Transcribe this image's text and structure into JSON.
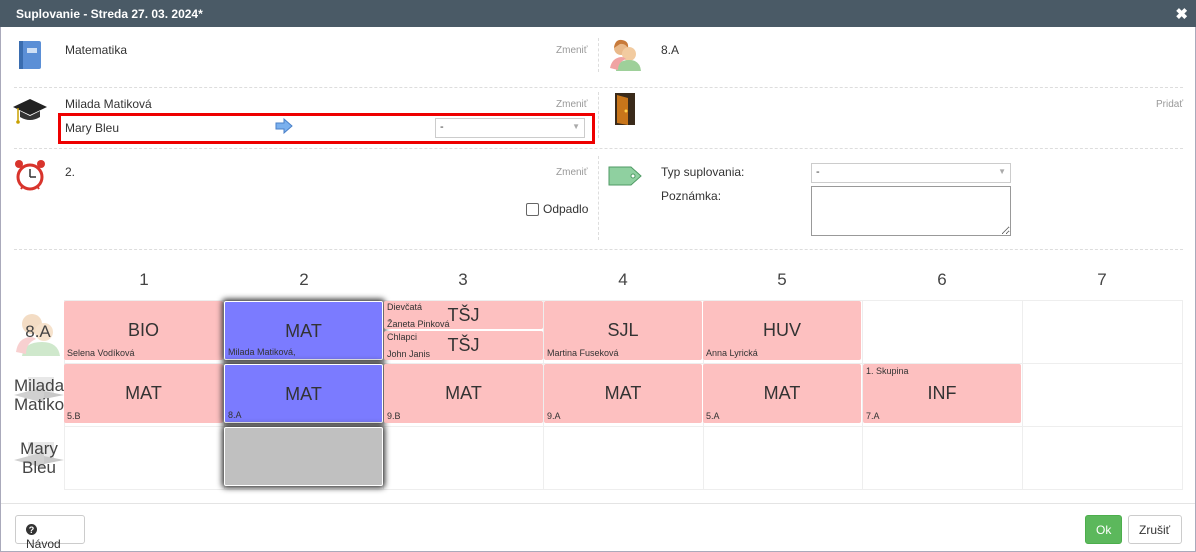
{
  "dialog": {
    "title": "Suplovanie - Streda 27. 03. 2024*",
    "close": "✖"
  },
  "subject": {
    "icon": "book-icon",
    "value": "Matematika",
    "change": "Zmeniť"
  },
  "klass": {
    "icon": "students-icon",
    "value": "8.A"
  },
  "teacher": {
    "icon": "graduation-cap-icon",
    "value": "Milada Matiková",
    "change": "Zmeniť",
    "substitute": "Mary Bleu",
    "arrow": "⇨",
    "select_value": "-"
  },
  "room": {
    "icon": "door-icon",
    "add": "Pridať"
  },
  "period": {
    "icon": "alarm-clock-icon",
    "value": "2.",
    "change": "Zmeniť",
    "cancelled_label": "Odpadlo"
  },
  "type": {
    "icon": "tag-icon",
    "label": "Typ suplovania:",
    "value": "-",
    "note_label": "Poznámka:"
  },
  "grid": {
    "columns": [
      "1",
      "2",
      "3",
      "4",
      "5",
      "6",
      "7"
    ],
    "rows": [
      {
        "label": "8.A",
        "icon": "students-icon"
      },
      {
        "label": "Milada Matiko",
        "icon": "teacher-icon"
      },
      {
        "label": "Mary Bleu",
        "icon": "teacher-icon"
      }
    ],
    "row1": [
      {
        "subject": "BIO",
        "note": "Selena Vodíková"
      },
      {
        "subject": "MAT",
        "note": "Milada Matiková,"
      },
      {
        "groups": [
          {
            "group": "Dievčatá",
            "subject": "TŠJ",
            "note": "Žaneta Pinková"
          },
          {
            "group": "Chlapci",
            "subject": "TŠJ",
            "note": "John Janis"
          }
        ]
      },
      {
        "subject": "SJL",
        "note": "Martina Fuseková"
      },
      {
        "subject": "HUV",
        "note": "Anna Lyrická"
      }
    ],
    "row2": [
      {
        "subject": "MAT",
        "note": "5.B"
      },
      {
        "subject": "MAT",
        "note": "8.A"
      },
      {
        "subject": "MAT",
        "note": "9.B"
      },
      {
        "subject": "MAT",
        "note": "9.A"
      },
      {
        "subject": "MAT",
        "note": "5.A"
      },
      {
        "subject": "INF",
        "note": "7.A",
        "group": "1. Skupina"
      }
    ]
  },
  "footer": {
    "help": "Návod",
    "help_icon": "question-circle-icon",
    "ok": "Ok",
    "cancel": "Zrušiť"
  }
}
